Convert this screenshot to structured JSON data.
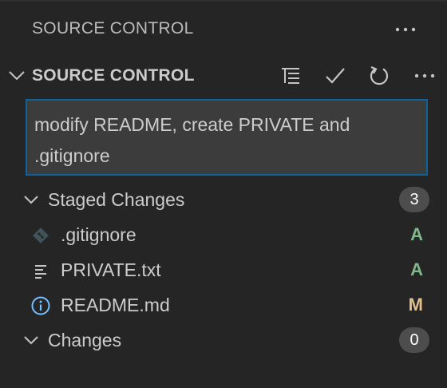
{
  "view": {
    "title": "SOURCE CONTROL",
    "more_icon": "more-horizontal-icon"
  },
  "section": {
    "title": "SOURCE CONTROL",
    "toolbar": [
      {
        "name": "view-as-tree-button",
        "icon": "list-tree-icon"
      },
      {
        "name": "commit-button",
        "icon": "check-icon"
      },
      {
        "name": "refresh-button",
        "icon": "refresh-icon"
      },
      {
        "name": "more-actions-button",
        "icon": "more-horizontal-icon"
      }
    ]
  },
  "commit": {
    "message": "modify README, create PRIVATE and .gitignore"
  },
  "staged": {
    "label": "Staged Changes",
    "count": "3",
    "files": [
      {
        "name": ".gitignore",
        "status": "A",
        "icon": "git-file-icon"
      },
      {
        "name": "PRIVATE.txt",
        "status": "A",
        "icon": "text-file-icon"
      },
      {
        "name": "README.md",
        "status": "M",
        "icon": "info-icon"
      }
    ]
  },
  "changes": {
    "label": "Changes",
    "count": "0"
  },
  "colors": {
    "background": "#252526",
    "input_background": "#3c3c3c",
    "focus_border": "#0e639c",
    "badge_background": "#4d4d4d",
    "added": "#81b88b",
    "modified": "#e2c08d",
    "info_icon": "#75beff",
    "git_icon": "#41535b"
  }
}
